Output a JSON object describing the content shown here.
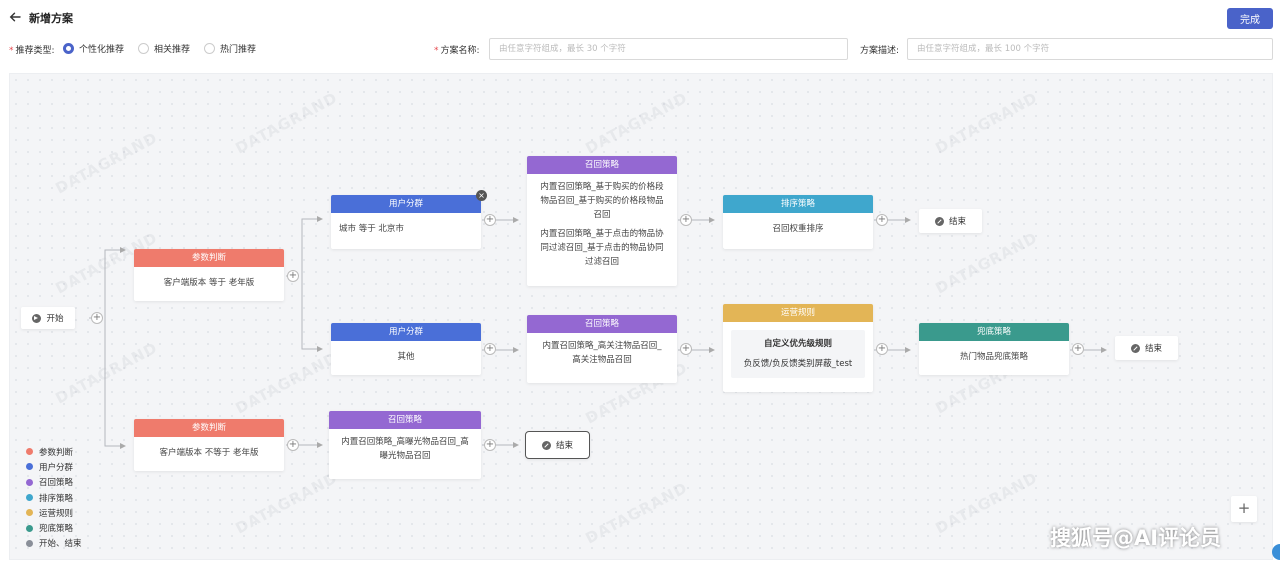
{
  "header": {
    "title": "新增方案",
    "done_label": "完成"
  },
  "form": {
    "type_label": "推荐类型:",
    "type_options": [
      "个性化推荐",
      "相关推荐",
      "热门推荐"
    ],
    "type_selected": "个性化推荐",
    "name_label": "方案名称:",
    "name_placeholder": "由任意字符组成，最长 30 个字符",
    "desc_label": "方案描述:",
    "desc_placeholder": "由任意字符组成，最长 100 个字符"
  },
  "watermark": "DATAGRAND",
  "nodes": {
    "start": {
      "label": "开始"
    },
    "param1": {
      "title": "参数判断",
      "body": "客户端版本 等于 老年版"
    },
    "param2": {
      "title": "参数判断",
      "body": "客户端版本 不等于 老年版"
    },
    "user1": {
      "title": "用户分群",
      "body": "城市 等于 北京市"
    },
    "user2": {
      "title": "用户分群",
      "body": "其他"
    },
    "recall1": {
      "title": "召回策略",
      "body1": "内置召回策略_基于购买的价格段物品召回_基于购买的价格段物品召回",
      "body2": "内置召回策略_基于点击的物品协同过滤召回_基于点击的物品协同过滤召回"
    },
    "recall2": {
      "title": "召回策略",
      "body": "内置召回策略_高关注物品召回_高关注物品召回"
    },
    "recall3": {
      "title": "召回策略",
      "body": "内置召回策略_高曝光物品召回_高曝光物品召回"
    },
    "sort1": {
      "title": "排序策略",
      "body": "召回权重排序"
    },
    "op1": {
      "title": "运营规则",
      "rule_title": "自定义优先级规则",
      "rule_body": "负反馈/负反馈类别屏蔽_test"
    },
    "fallback1": {
      "title": "兜底策略",
      "body": "热门物品兜底策略"
    },
    "end1": {
      "label": "结束"
    },
    "end2": {
      "label": "结束"
    },
    "end3": {
      "label": "结束"
    }
  },
  "legend": [
    {
      "label": "参数判断",
      "color": "#ef7b6c"
    },
    {
      "label": "用户分群",
      "color": "#4a6fd8"
    },
    {
      "label": "召回策略",
      "color": "#9468d2"
    },
    {
      "label": "排序策略",
      "color": "#3fa7cd"
    },
    {
      "label": "运营规则",
      "color": "#e3b556"
    },
    {
      "label": "兜底策略",
      "color": "#3a9a8d"
    },
    {
      "label": "开始、结束",
      "color": "#8a8f99"
    }
  ],
  "brand": "搜狐号@AI评论员"
}
